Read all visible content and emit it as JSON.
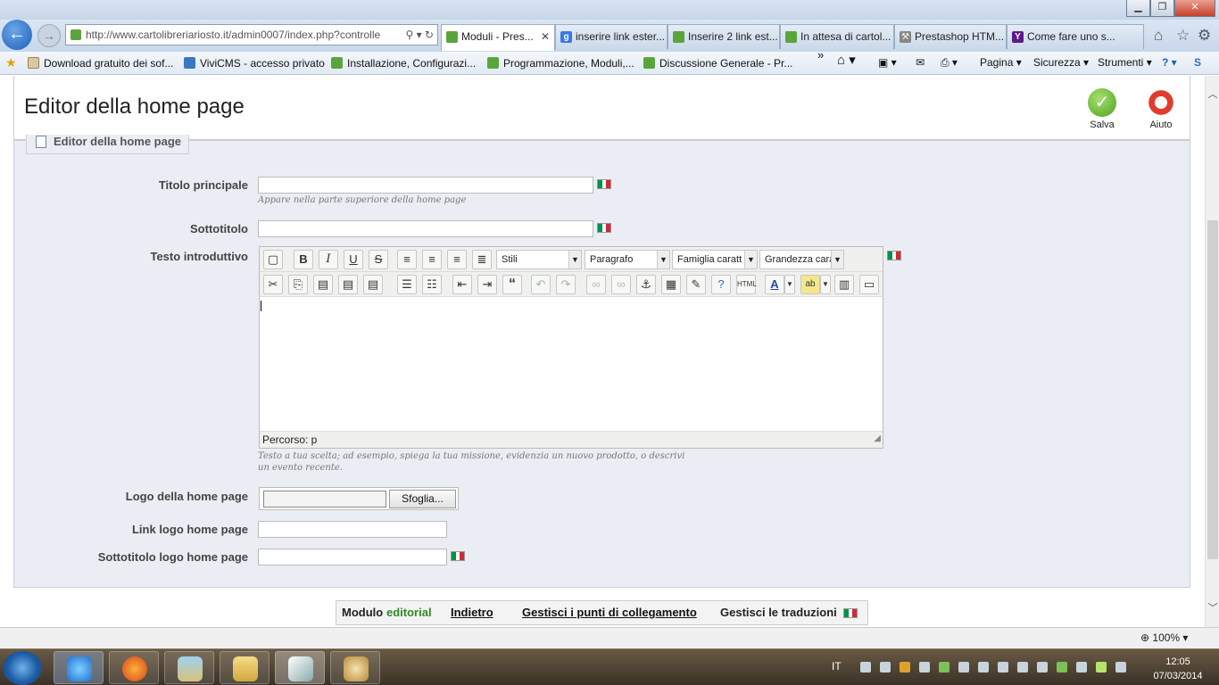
{
  "browser": {
    "url": "http://www.cartolibreriariosto.it/admin0007/index.php?controlle",
    "tabs": [
      {
        "label": "Moduli - Pres...",
        "active": true
      },
      {
        "label": "inserire link ester..."
      },
      {
        "label": "Inserire 2 link est..."
      },
      {
        "label": "In attesa di cartol..."
      },
      {
        "label": "Prestashop HTM..."
      },
      {
        "label": "Come fare uno s..."
      }
    ],
    "favorites": [
      "Download gratuito dei sof...",
      "ViviCMS - accesso privato",
      "Installazione, Configurazi...",
      "Programmazione, Moduli,...",
      "Discussione Generale - Pr..."
    ],
    "commands": {
      "page": "Pagina",
      "security": "Sicurezza",
      "tools": "Strumenti"
    },
    "zoom": "100%",
    "chevron": "»"
  },
  "header": {
    "title": "Editor della home page",
    "save": "Salva",
    "help": "Aiuto"
  },
  "panel": {
    "legend": "Editor della home page",
    "fields": {
      "main_title": {
        "label": "Titolo principale",
        "value": "",
        "hint": "Appare nella parte superiore della home page"
      },
      "subtitle": {
        "label": "Sottotitolo",
        "value": ""
      },
      "intro": {
        "label": "Testo introduttivo",
        "hint": "Testo a tua scelta; ad esempio, spiega la tua missione, evidenzia un nuovo prodotto, o descrivi un evento recente."
      },
      "logo": {
        "label": "Logo della home page",
        "browse": "Sfoglia..."
      },
      "logo_link": {
        "label": "Link logo home page",
        "value": ""
      },
      "logo_subtitle": {
        "label": "Sottotitolo logo home page",
        "value": ""
      }
    },
    "editor": {
      "styles": "Stili",
      "format": "Paragrafo",
      "font_family": "Famiglia caratt",
      "font_size": "Grandezza cara",
      "path": "Percorso: p"
    }
  },
  "footer": {
    "module_label": "Modulo",
    "module_name": "editorial",
    "back": "Indietro",
    "hooks": "Gestisci i punti di collegamento",
    "translations": "Gestisci le traduzioni"
  },
  "taskbar": {
    "lang": "IT",
    "time": "12:05",
    "date": "07/03/2014"
  },
  "colors": {
    "panel_bg": "#ebedf4",
    "module_name": "#2e8b22",
    "flag_green": "#009246",
    "flag_white": "#ffffff",
    "flag_red": "#ce2b37"
  }
}
